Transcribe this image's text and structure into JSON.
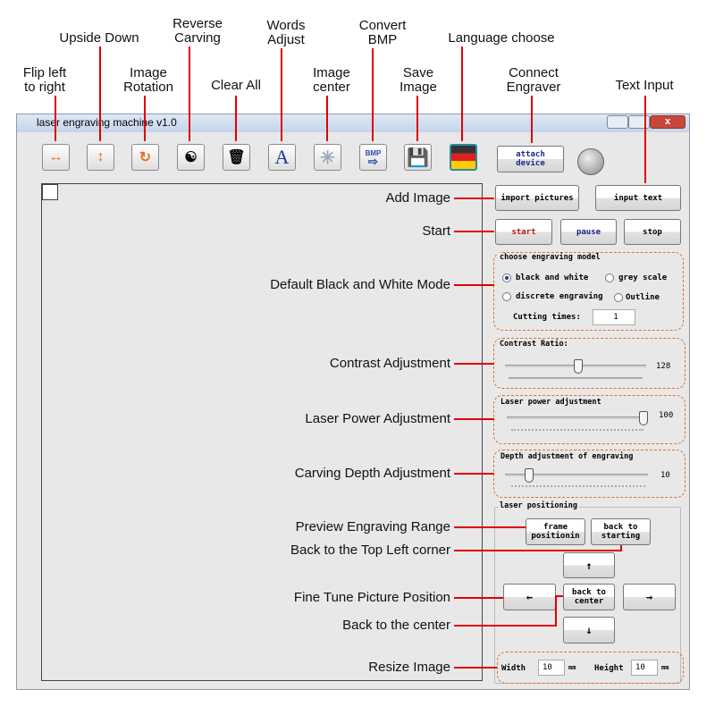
{
  "annotations": {
    "top": [
      "Flip left\nto right",
      "Upside Down",
      "Image\nRotation",
      "Reverse\nCarving",
      "Clear All",
      "Words\nAdjust",
      "Image\ncenter",
      "Convert\nBMP",
      "Save\nImage",
      "Language choose",
      "Connect\nEngraver",
      "Text Input"
    ],
    "left": [
      "Add Image",
      "Start",
      "Default Black and White Mode",
      "Contrast Adjustment",
      "Laser Power Adjustment",
      "Carving Depth Adjustment",
      "Preview Engraving Range",
      "Back to the Top Left corner",
      "Fine Tune Picture Position",
      "Back to the center",
      "Resize Image"
    ],
    "color": "#e00000"
  },
  "window": {
    "title": "laser engraving machine v1.0"
  },
  "toolbar": {
    "icons": [
      "flip-horizontal",
      "flip-vertical",
      "rotate",
      "yin-yang",
      "trash",
      "letter-a",
      "starburst",
      "bmp-convert",
      "floppy-disk",
      "flag"
    ],
    "icon_text": {
      "letter": "A",
      "bmp": "BMP"
    },
    "attach": "attach\ndevice"
  },
  "panel": {
    "import": "import pictures",
    "input_text": "input text",
    "start": "start",
    "pause": "pause",
    "stop": "stop",
    "model": {
      "title": "choose engraving model",
      "options": [
        "black and white",
        "grey scale",
        "discrete engraving",
        "Outline"
      ],
      "selected": "black and white",
      "cutting_label": "Cutting times:",
      "cutting_value": "1"
    },
    "contrast": {
      "title": "Contrast Ratio:",
      "value": "128",
      "fraction": 0.5
    },
    "power": {
      "title": "Laser power adjustment",
      "value": "100",
      "fraction": 1.0
    },
    "depth": {
      "title": "Depth adjustment of engraving",
      "value": "10",
      "fraction": 0.1
    },
    "positioning": {
      "title": "laser positioning",
      "frame": "frame\npositionin",
      "back_start": "back to\nstarting",
      "up": "↑",
      "left": "←",
      "center": "back to\ncenter",
      "right": "→",
      "down": "↓"
    },
    "resize": {
      "width_label": "Width",
      "width": "10",
      "height_label": "Height",
      "height": "10",
      "unit": "mm"
    }
  }
}
